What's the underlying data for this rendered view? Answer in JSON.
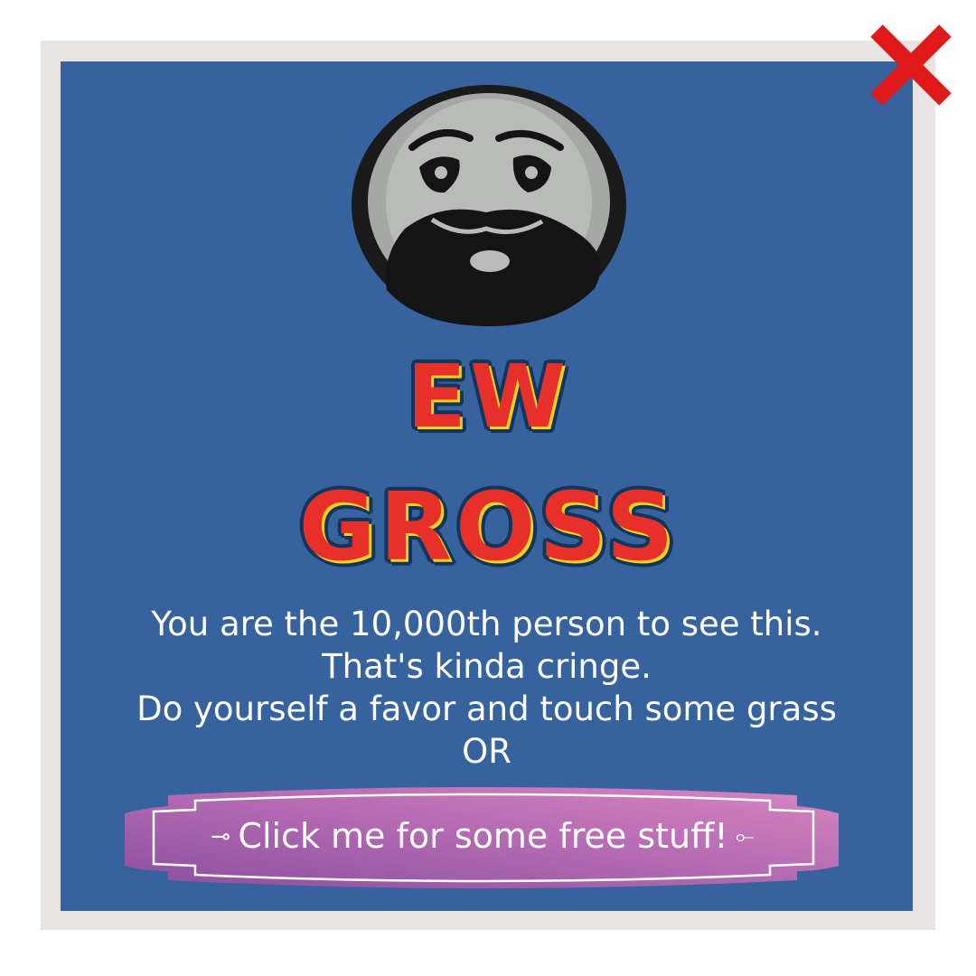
{
  "dialog": {
    "close_icon": "close-x-icon",
    "avatar_icon": "troll-face-image",
    "headline_line1": "EW",
    "headline_line2": "GROSS",
    "message_lines": [
      "You are the 10,000th person to see this.",
      "That's kinda cringe.",
      "Do yourself a favor and touch some grass",
      "OR"
    ],
    "cta_label": "Click me for some free stuff!",
    "colors": {
      "panel": "#36629d",
      "frame": "#e8e4e3",
      "close": "#e0191a",
      "headline": "#e8302a",
      "headline_highlight": "#f4d21c",
      "cta_start": "#8c4ea0",
      "cta_end": "#d985c2"
    }
  }
}
